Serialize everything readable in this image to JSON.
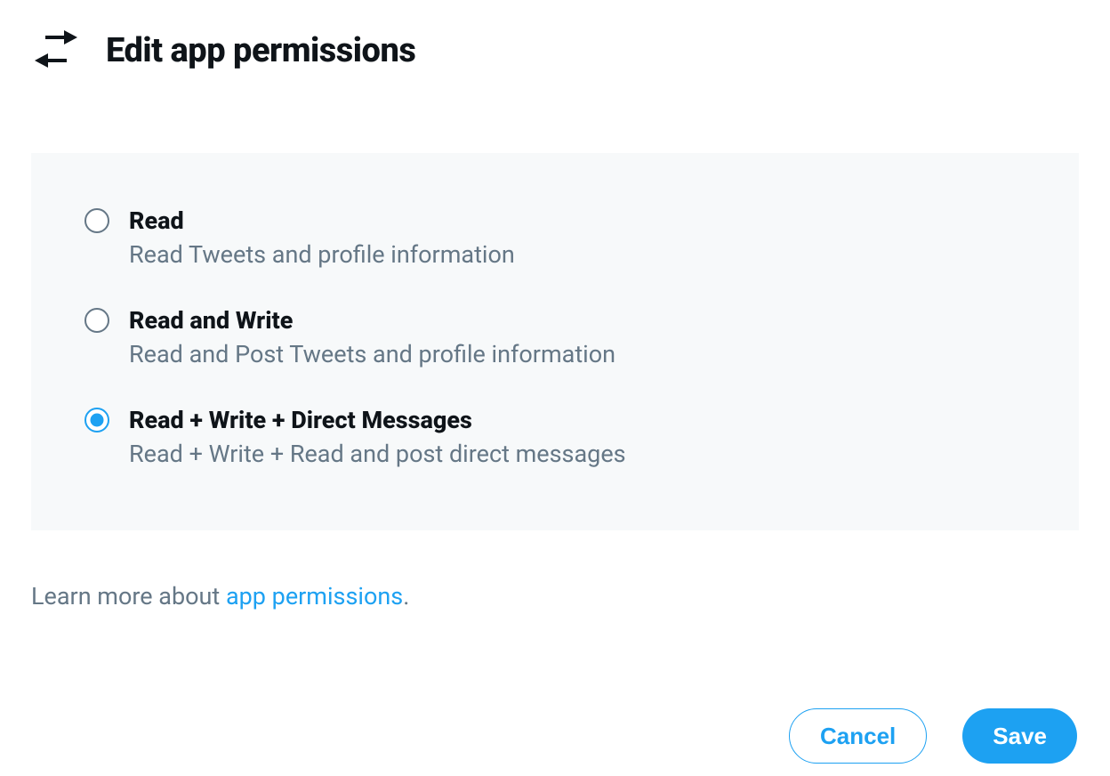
{
  "header": {
    "title": "Edit app permissions"
  },
  "options": [
    {
      "label": "Read",
      "description": "Read Tweets and profile information",
      "selected": false
    },
    {
      "label": "Read and Write",
      "description": "Read and Post Tweets and profile information",
      "selected": false
    },
    {
      "label": "Read + Write + Direct Messages",
      "description": "Read + Write + Read and post direct messages",
      "selected": true
    }
  ],
  "learn_more": {
    "prefix": "Learn more about ",
    "link_text": "app permissions",
    "suffix": "."
  },
  "buttons": {
    "cancel": "Cancel",
    "save": "Save"
  }
}
